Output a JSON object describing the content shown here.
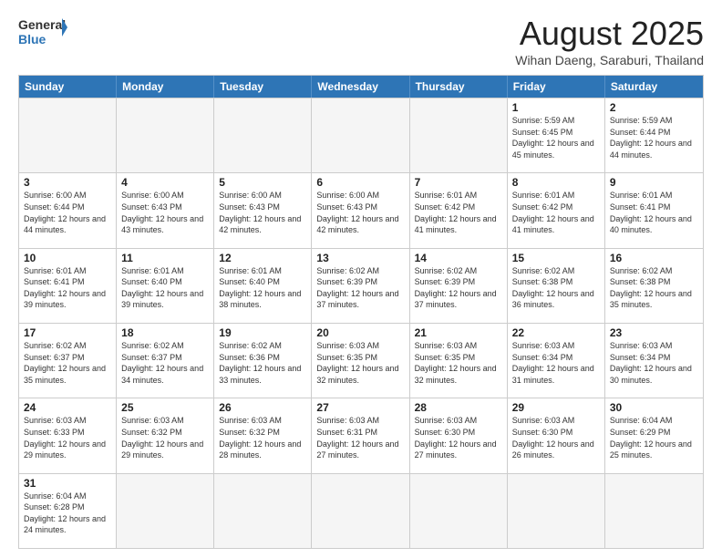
{
  "header": {
    "logo_general": "General",
    "logo_blue": "Blue",
    "month_title": "August 2025",
    "subtitle": "Wihan Daeng, Saraburi, Thailand"
  },
  "days_of_week": [
    "Sunday",
    "Monday",
    "Tuesday",
    "Wednesday",
    "Thursday",
    "Friday",
    "Saturday"
  ],
  "weeks": [
    [
      {
        "day": "",
        "info": ""
      },
      {
        "day": "",
        "info": ""
      },
      {
        "day": "",
        "info": ""
      },
      {
        "day": "",
        "info": ""
      },
      {
        "day": "",
        "info": ""
      },
      {
        "day": "1",
        "info": "Sunrise: 5:59 AM\nSunset: 6:45 PM\nDaylight: 12 hours and 45 minutes."
      },
      {
        "day": "2",
        "info": "Sunrise: 5:59 AM\nSunset: 6:44 PM\nDaylight: 12 hours and 44 minutes."
      }
    ],
    [
      {
        "day": "3",
        "info": "Sunrise: 6:00 AM\nSunset: 6:44 PM\nDaylight: 12 hours and 44 minutes."
      },
      {
        "day": "4",
        "info": "Sunrise: 6:00 AM\nSunset: 6:43 PM\nDaylight: 12 hours and 43 minutes."
      },
      {
        "day": "5",
        "info": "Sunrise: 6:00 AM\nSunset: 6:43 PM\nDaylight: 12 hours and 42 minutes."
      },
      {
        "day": "6",
        "info": "Sunrise: 6:00 AM\nSunset: 6:43 PM\nDaylight: 12 hours and 42 minutes."
      },
      {
        "day": "7",
        "info": "Sunrise: 6:01 AM\nSunset: 6:42 PM\nDaylight: 12 hours and 41 minutes."
      },
      {
        "day": "8",
        "info": "Sunrise: 6:01 AM\nSunset: 6:42 PM\nDaylight: 12 hours and 41 minutes."
      },
      {
        "day": "9",
        "info": "Sunrise: 6:01 AM\nSunset: 6:41 PM\nDaylight: 12 hours and 40 minutes."
      }
    ],
    [
      {
        "day": "10",
        "info": "Sunrise: 6:01 AM\nSunset: 6:41 PM\nDaylight: 12 hours and 39 minutes."
      },
      {
        "day": "11",
        "info": "Sunrise: 6:01 AM\nSunset: 6:40 PM\nDaylight: 12 hours and 39 minutes."
      },
      {
        "day": "12",
        "info": "Sunrise: 6:01 AM\nSunset: 6:40 PM\nDaylight: 12 hours and 38 minutes."
      },
      {
        "day": "13",
        "info": "Sunrise: 6:02 AM\nSunset: 6:39 PM\nDaylight: 12 hours and 37 minutes."
      },
      {
        "day": "14",
        "info": "Sunrise: 6:02 AM\nSunset: 6:39 PM\nDaylight: 12 hours and 37 minutes."
      },
      {
        "day": "15",
        "info": "Sunrise: 6:02 AM\nSunset: 6:38 PM\nDaylight: 12 hours and 36 minutes."
      },
      {
        "day": "16",
        "info": "Sunrise: 6:02 AM\nSunset: 6:38 PM\nDaylight: 12 hours and 35 minutes."
      }
    ],
    [
      {
        "day": "17",
        "info": "Sunrise: 6:02 AM\nSunset: 6:37 PM\nDaylight: 12 hours and 35 minutes."
      },
      {
        "day": "18",
        "info": "Sunrise: 6:02 AM\nSunset: 6:37 PM\nDaylight: 12 hours and 34 minutes."
      },
      {
        "day": "19",
        "info": "Sunrise: 6:02 AM\nSunset: 6:36 PM\nDaylight: 12 hours and 33 minutes."
      },
      {
        "day": "20",
        "info": "Sunrise: 6:03 AM\nSunset: 6:35 PM\nDaylight: 12 hours and 32 minutes."
      },
      {
        "day": "21",
        "info": "Sunrise: 6:03 AM\nSunset: 6:35 PM\nDaylight: 12 hours and 32 minutes."
      },
      {
        "day": "22",
        "info": "Sunrise: 6:03 AM\nSunset: 6:34 PM\nDaylight: 12 hours and 31 minutes."
      },
      {
        "day": "23",
        "info": "Sunrise: 6:03 AM\nSunset: 6:34 PM\nDaylight: 12 hours and 30 minutes."
      }
    ],
    [
      {
        "day": "24",
        "info": "Sunrise: 6:03 AM\nSunset: 6:33 PM\nDaylight: 12 hours and 29 minutes."
      },
      {
        "day": "25",
        "info": "Sunrise: 6:03 AM\nSunset: 6:32 PM\nDaylight: 12 hours and 29 minutes."
      },
      {
        "day": "26",
        "info": "Sunrise: 6:03 AM\nSunset: 6:32 PM\nDaylight: 12 hours and 28 minutes."
      },
      {
        "day": "27",
        "info": "Sunrise: 6:03 AM\nSunset: 6:31 PM\nDaylight: 12 hours and 27 minutes."
      },
      {
        "day": "28",
        "info": "Sunrise: 6:03 AM\nSunset: 6:30 PM\nDaylight: 12 hours and 27 minutes."
      },
      {
        "day": "29",
        "info": "Sunrise: 6:03 AM\nSunset: 6:30 PM\nDaylight: 12 hours and 26 minutes."
      },
      {
        "day": "30",
        "info": "Sunrise: 6:04 AM\nSunset: 6:29 PM\nDaylight: 12 hours and 25 minutes."
      }
    ],
    [
      {
        "day": "31",
        "info": "Sunrise: 6:04 AM\nSunset: 6:28 PM\nDaylight: 12 hours and 24 minutes."
      },
      {
        "day": "",
        "info": ""
      },
      {
        "day": "",
        "info": ""
      },
      {
        "day": "",
        "info": ""
      },
      {
        "day": "",
        "info": ""
      },
      {
        "day": "",
        "info": ""
      },
      {
        "day": "",
        "info": ""
      }
    ]
  ]
}
